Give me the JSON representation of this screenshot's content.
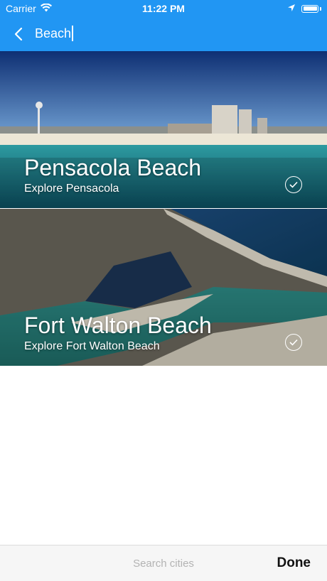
{
  "status_bar": {
    "carrier": "Carrier",
    "time": "11:22 PM"
  },
  "search": {
    "query": "Beach"
  },
  "results": [
    {
      "title": "Pensacola Beach",
      "subtitle": "Explore Pensacola",
      "selected": true
    },
    {
      "title": "Fort Walton Beach",
      "subtitle": "Explore Fort Walton Beach",
      "selected": true
    }
  ],
  "footer": {
    "placeholder": "Search cities",
    "done_label": "Done"
  },
  "colors": {
    "header": "#2196F3",
    "text_on_header": "#ffffff"
  },
  "icons": {
    "back": "chevron-left-icon",
    "wifi": "wifi-icon",
    "location": "location-arrow-icon",
    "battery": "battery-icon",
    "check": "check-circle-icon"
  }
}
